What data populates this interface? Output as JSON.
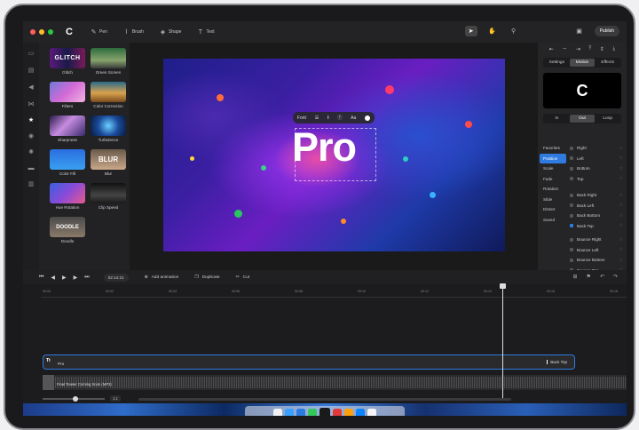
{
  "app": {
    "toolbar": {
      "tools": [
        {
          "label": "Pen",
          "icon": "pen-icon"
        },
        {
          "label": "Brush",
          "icon": "brush-icon"
        },
        {
          "label": "Shape",
          "icon": "shape-icon"
        },
        {
          "label": "Text",
          "icon": "text-icon"
        }
      ],
      "publish_label": "Publish"
    },
    "effects": [
      {
        "label": "Glitch",
        "thumb_text": "GLITCH"
      },
      {
        "label": "Green Screen",
        "thumb_text": ""
      },
      {
        "label": "Filters",
        "thumb_text": ""
      },
      {
        "label": "Color Correction",
        "thumb_text": ""
      },
      {
        "label": "Sharpness",
        "thumb_text": ""
      },
      {
        "label": "Turbulence",
        "thumb_text": ""
      },
      {
        "label": "Color Fill",
        "thumb_text": ""
      },
      {
        "label": "Blur",
        "thumb_text": "BLUR"
      },
      {
        "label": "Hue Rotation",
        "thumb_text": ""
      },
      {
        "label": "Clip Speed",
        "thumb_text": ""
      },
      {
        "label": "Doodle",
        "thumb_text": "DOODLE"
      }
    ],
    "canvas": {
      "overlay_text": "Pro",
      "text_toolbar": {
        "font_label": "Font",
        "size_label": "Aa"
      }
    },
    "inspector": {
      "tabs": [
        "Settings",
        "Motion",
        "Effects"
      ],
      "active_tab": "Motion",
      "direction_tabs": [
        "In",
        "Out",
        "Loop"
      ],
      "active_direction": "Out",
      "categories": [
        "Favorites",
        "Position",
        "Scale",
        "Fade",
        "Rotation",
        "Slide",
        "Distort",
        "Saved"
      ],
      "active_category": "Position",
      "options": [
        {
          "label": "Right",
          "checked": false
        },
        {
          "label": "Left",
          "checked": false
        },
        {
          "label": "Bottom",
          "checked": false
        },
        {
          "label": "Top",
          "checked": false
        },
        {
          "label": "Back Right",
          "checked": false
        },
        {
          "label": "Back Left",
          "checked": false
        },
        {
          "label": "Back Bottom",
          "checked": false
        },
        {
          "label": "Back Top",
          "checked": true
        },
        {
          "label": "Bounce Right",
          "checked": false
        },
        {
          "label": "Bounce Left",
          "checked": false
        },
        {
          "label": "Bounce Bottom",
          "checked": false
        },
        {
          "label": "Bounce Top",
          "checked": false
        },
        {
          "label": "Elastic Right",
          "checked": false
        }
      ]
    },
    "timeline": {
      "timecode": "02:14:21",
      "actions": [
        {
          "label": "Add animation",
          "icon": "add-animation-icon"
        },
        {
          "label": "Duplicate",
          "icon": "duplicate-icon"
        },
        {
          "label": "Cut",
          "icon": "scissors-icon"
        }
      ],
      "ruler_ticks": [
        "00:00",
        "00:02",
        "00:04",
        "00:06",
        "00:08",
        "00:10",
        "00:12",
        "00:14",
        "00:16",
        "00:18"
      ],
      "text_track": {
        "tag": "Tt",
        "name": "Pro",
        "animation": "Back Top"
      },
      "audio_track": {
        "name": "Final Teaser Coming Soon (MP3)"
      },
      "zoom_value": "1:1"
    }
  },
  "colors": {
    "accent": "#2f7be0",
    "window_bg": "#1b1b1d",
    "panel_bg": "#252527"
  }
}
